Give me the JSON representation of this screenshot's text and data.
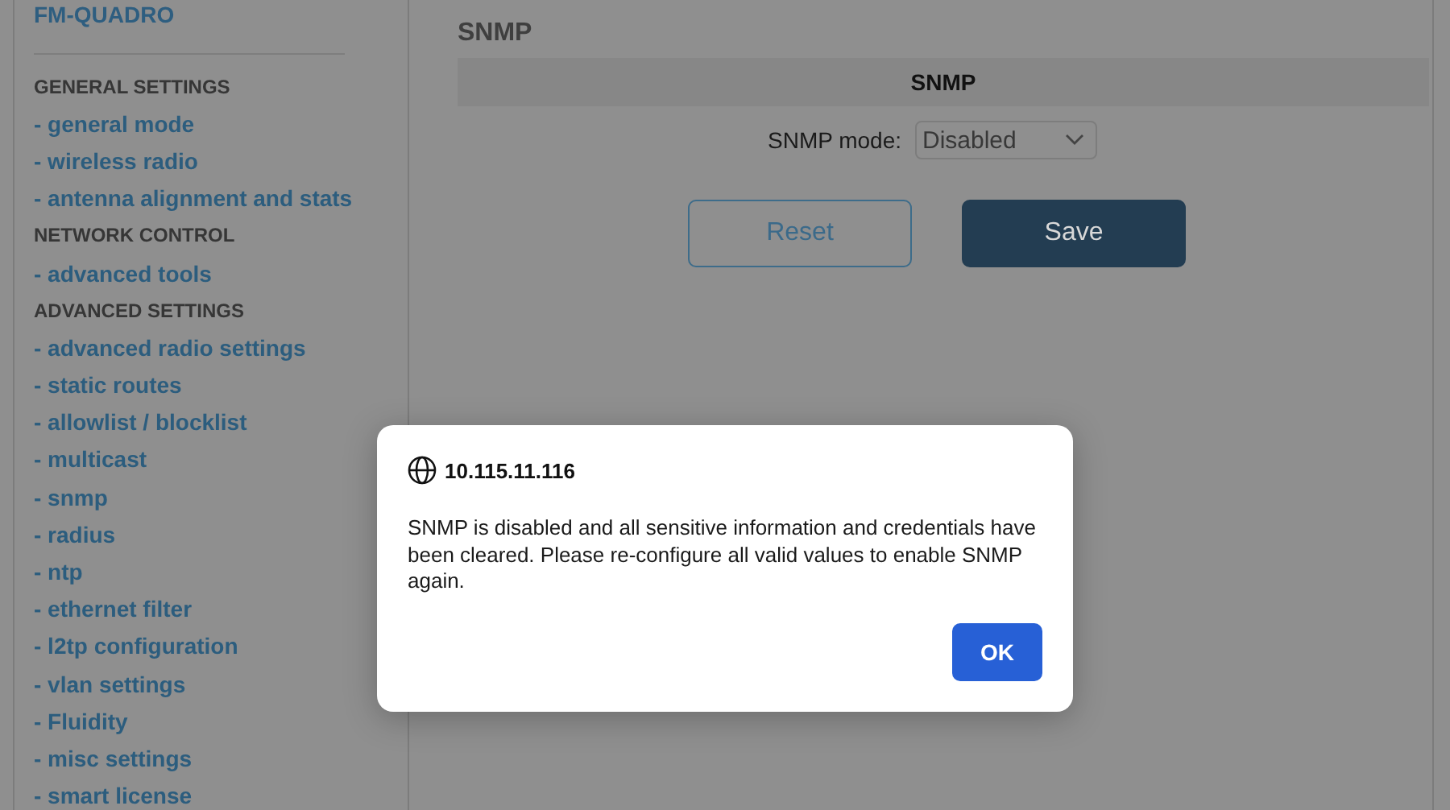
{
  "sidebar": {
    "logo": "FM-QUADRO",
    "items": [
      {
        "kind": "heading",
        "label": "GENERAL SETTINGS"
      },
      {
        "kind": "link",
        "label": "- general mode"
      },
      {
        "kind": "link",
        "label": "- wireless radio"
      },
      {
        "kind": "link",
        "label": "- antenna alignment and stats"
      },
      {
        "kind": "heading",
        "label": "NETWORK CONTROL"
      },
      {
        "kind": "link",
        "label": "- advanced tools"
      },
      {
        "kind": "heading",
        "label": "ADVANCED SETTINGS"
      },
      {
        "kind": "link",
        "label": "- advanced radio settings"
      },
      {
        "kind": "link",
        "label": "- static routes"
      },
      {
        "kind": "link",
        "label": "- allowlist / blocklist"
      },
      {
        "kind": "link",
        "label": "- multicast"
      },
      {
        "kind": "link",
        "label": "- snmp"
      },
      {
        "kind": "link",
        "label": "- radius"
      },
      {
        "kind": "link",
        "label": "- ntp"
      },
      {
        "kind": "link",
        "label": "- ethernet filter"
      },
      {
        "kind": "link",
        "label": "- l2tp configuration"
      },
      {
        "kind": "link",
        "label": "- vlan settings"
      },
      {
        "kind": "link",
        "label": "- Fluidity"
      },
      {
        "kind": "link",
        "label": "- misc settings"
      },
      {
        "kind": "link",
        "label": "- smart license"
      }
    ]
  },
  "main": {
    "title": "SNMP",
    "section_header": "SNMP",
    "field": {
      "label": "SNMP mode:",
      "value": "Disabled"
    },
    "buttons": [
      {
        "kind": "secondary",
        "label": "Reset"
      },
      {
        "kind": "primary",
        "label": "Save"
      }
    ]
  },
  "dialog": {
    "title": "10.115.11.116",
    "message": "SNMP is disabled and all sensitive information and credentials have been cleared. Please re-configure all valid values to enable SNMP again.",
    "button": "OK"
  }
}
